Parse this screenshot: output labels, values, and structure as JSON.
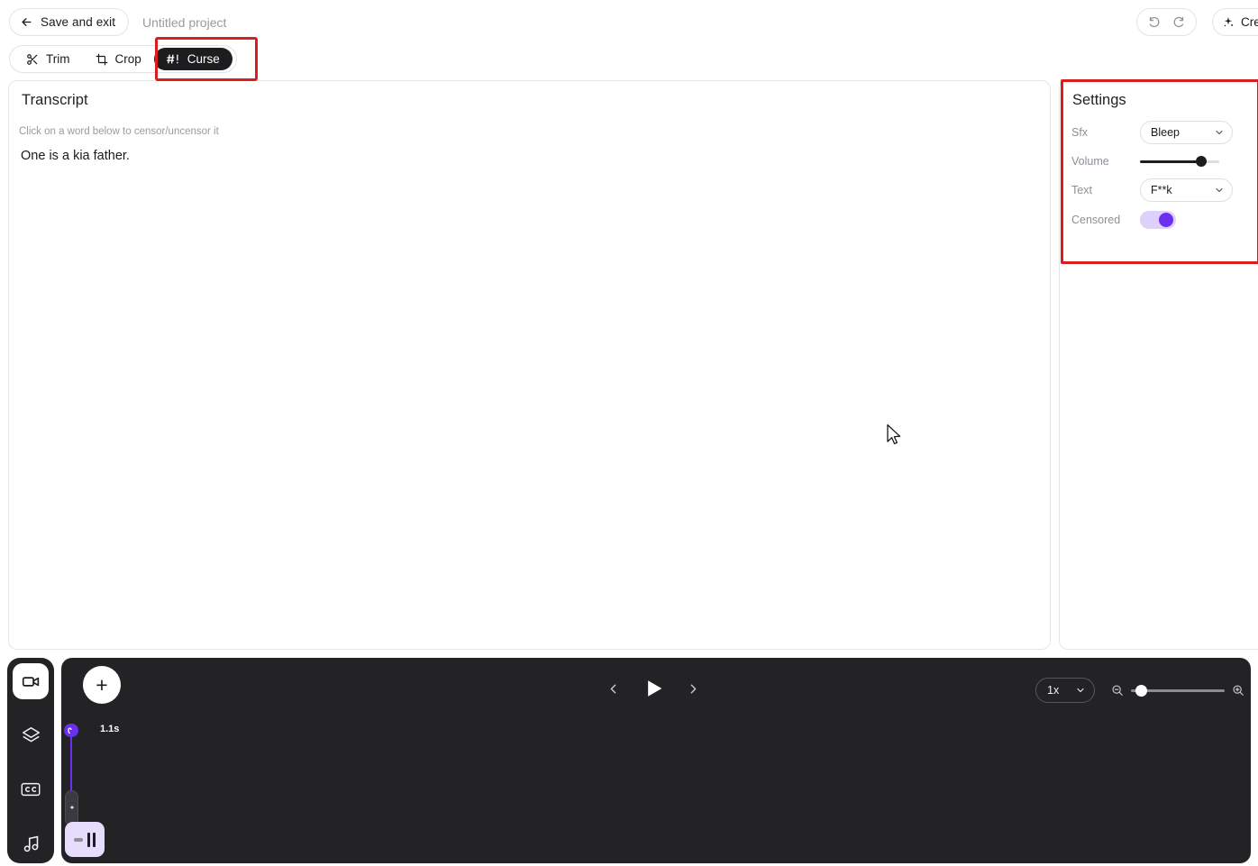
{
  "topbar": {
    "save_exit_label": "Save and exit",
    "back_arrow_icon": "arrow-left-icon",
    "project_title": "Untitled project",
    "undo_icon": "undo-icon",
    "redo_icon": "redo-icon",
    "create_label": "Crea",
    "create_sparkle_icon": "sparkle-icon"
  },
  "tools": {
    "items": [
      {
        "label": "Trim",
        "icon": "scissors-icon",
        "active": false
      },
      {
        "label": "Crop",
        "icon": "crop-icon",
        "active": false
      },
      {
        "label": "Curse",
        "icon": "hash-bang-icon",
        "active": true
      }
    ]
  },
  "transcript": {
    "title": "Transcript",
    "hint": "Click on a word below to censor/uncensor it",
    "words": [
      "One",
      "is",
      "a",
      "kia",
      "father."
    ]
  },
  "settings": {
    "title": "Settings",
    "rows": [
      {
        "label": "Sfx",
        "type": "select",
        "value": "Bleep"
      },
      {
        "label": "Volume",
        "type": "slider",
        "value": "77"
      },
      {
        "label": "Text",
        "type": "select",
        "value": "F**k"
      },
      {
        "label": "Censored",
        "type": "toggle",
        "value": "on"
      }
    ],
    "chevron_icon": "chevron-down-icon"
  },
  "rail": {
    "items": [
      {
        "name": "video-icon",
        "active": true
      },
      {
        "name": "layers-icon",
        "active": false
      },
      {
        "name": "captions-icon",
        "active": false
      },
      {
        "name": "audio-icon",
        "active": false
      }
    ]
  },
  "timeline": {
    "add_label": "+",
    "prev_icon": "chevron-left-icon",
    "play_icon": "play-icon",
    "next_icon": "chevron-right-icon",
    "speed_value": "1x",
    "zoom_out_icon": "zoom-out-icon",
    "zoom_in_icon": "zoom-in-icon",
    "zoom_value": "8",
    "clip_badge_label": "0",
    "clip_duration": "1.1s",
    "sparkle_icon": "sparkle-icon"
  },
  "colors": {
    "accent_purple": "#6b2ff0",
    "clip_lavender": "#e6dcfb",
    "annotation_red": "#d81f1f",
    "panel_dark": "#232326"
  },
  "cursor": {
    "icon": "arrow-cursor"
  }
}
